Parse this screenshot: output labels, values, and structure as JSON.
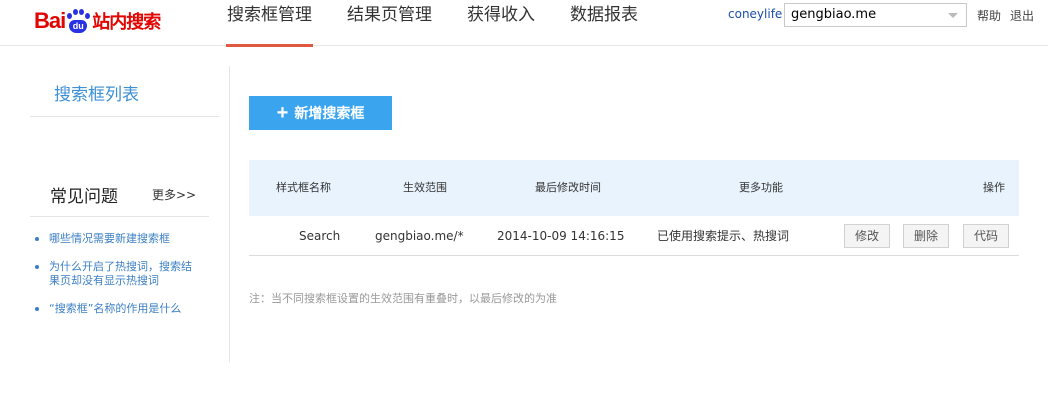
{
  "header": {
    "logo": {
      "bai": "Bai",
      "du": "du",
      "sub": "站内搜索"
    },
    "nav": [
      {
        "label": "搜索框管理",
        "active": true
      },
      {
        "label": "结果页管理",
        "active": false
      },
      {
        "label": "获得收入",
        "active": false
      },
      {
        "label": "数据报表",
        "active": false
      }
    ],
    "user": "coneylife",
    "site_select": {
      "value": "gengbiao.me"
    },
    "help": "帮助",
    "logout": "退出"
  },
  "sidebar": {
    "title": "搜索框列表",
    "faq_title": "常见问题",
    "faq_more": "更多>>",
    "faq_items": [
      "哪些情况需要新建搜索框",
      "为什么开启了热搜词，搜索结果页却没有显示热搜词",
      "“搜索框”名称的作用是什么"
    ]
  },
  "main": {
    "add_button": "新增搜索框",
    "table": {
      "headers": [
        "样式框名称",
        "生效范围",
        "最后修改时间",
        "更多功能",
        "操作"
      ],
      "rows": [
        {
          "name": "Search",
          "scope": "gengbiao.me/*",
          "modified": "2014-10-09 14:16:15",
          "features": "已使用搜索提示、热搜词",
          "actions": [
            "修改",
            "删除",
            "代码"
          ]
        }
      ]
    },
    "note": "注：当不同搜索框设置的生效范围有重叠时，以最后修改的为准"
  },
  "colors": {
    "brand_red": "#e10602",
    "brand_blue": "#2932e1",
    "nav_active_underline": "#e0583f",
    "primary_button": "#3aa5ee",
    "table_header_bg": "#e8f3fd",
    "link_blue": "#3b7fc4"
  },
  "icons": {
    "logo": "baidu-paw-icon",
    "add": "plus-icon",
    "select": "caret-down-icon",
    "faq_bullet": "bullet-dot-icon"
  }
}
